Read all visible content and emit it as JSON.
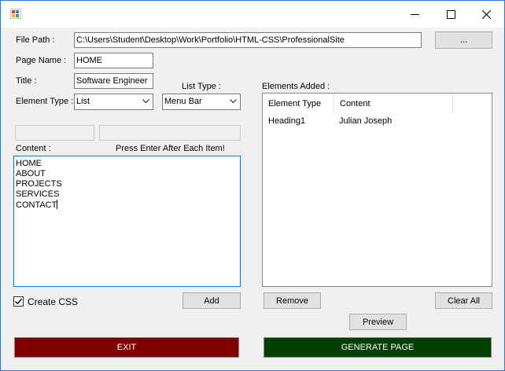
{
  "window": {
    "caption_buttons": [
      "minimize-icon",
      "maximize-icon",
      "close-icon"
    ],
    "accent": "#0078d7"
  },
  "form": {
    "file_path_label": "File Path :",
    "file_path_value": "C:\\Users\\Student\\Desktop\\Work\\Portfolio\\HTML-CSS\\ProfessionalSite",
    "browse_label": "...",
    "page_name_label": "Page Name :",
    "page_name_value": "HOME",
    "title_label": "Title :",
    "title_value": "Software Engineer",
    "element_type_label": "Element Type :",
    "element_type_value": "List",
    "list_type_label": "List Type :",
    "list_type_value": "Menu Bar",
    "content_label": "Content :",
    "hint": "Press Enter After Each Item!",
    "content_lines": [
      "HOME",
      "ABOUT",
      "PROJECTS",
      "SERVICES",
      "CONTACT"
    ],
    "create_css_label": "Create CSS",
    "create_css_checked": true,
    "add_label": "Add"
  },
  "elements": {
    "label": "Elements Added :",
    "columns": [
      "Element Type",
      "Content"
    ],
    "rows": [
      {
        "type": "Heading1",
        "content": "Julian Joseph"
      }
    ],
    "remove_label": "Remove",
    "clear_label": "Clear All",
    "preview_label": "Preview"
  },
  "actions": {
    "exit_label": "EXIT",
    "exit_color": "#800000",
    "generate_label": "GENERATE PAGE",
    "generate_color": "#004000"
  }
}
